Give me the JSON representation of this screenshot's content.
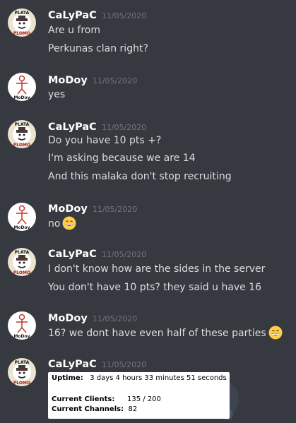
{
  "messages": [
    {
      "author": "CaLyPaC",
      "avatar": "plata-o-plomo-avatar",
      "timestamp": "11/05/2020",
      "lines": [
        "Are u from",
        "Perkunas clan right?"
      ]
    },
    {
      "author": "MoDoy",
      "avatar": "stick-figure-modoy-avatar",
      "timestamp": "11/05/2020",
      "lines": [
        "yes"
      ]
    },
    {
      "author": "CaLyPaC",
      "avatar": "plata-o-plomo-avatar",
      "timestamp": "11/05/2020",
      "lines": [
        "Do you have 10 pts +?",
        "I'm asking because we are 14",
        "And this malaka don't stop recruiting"
      ]
    },
    {
      "author": "MoDoy",
      "avatar": "stick-figure-modoy-avatar",
      "timestamp": "11/05/2020",
      "lines": [
        "no"
      ],
      "emoji": "grinning-face-emoji"
    },
    {
      "author": "CaLyPaC",
      "avatar": "plata-o-plomo-avatar",
      "timestamp": "11/05/2020",
      "lines": [
        "I don't know how are the sides in the server",
        "You don't have 10 pts? they said u have 16"
      ]
    },
    {
      "author": "MoDoy",
      "avatar": "stick-figure-modoy-avatar",
      "timestamp": "11/05/2020",
      "lines": [
        "16? we dont have even half of these parties"
      ],
      "emoji": "grinning-face-emoji"
    },
    {
      "author": "CaLyPaC",
      "avatar": "plata-o-plomo-avatar",
      "timestamp": "11/05/2020",
      "lines": []
    }
  ],
  "server_stats": {
    "uptime_label": "Uptime:",
    "uptime_value": "3 days 4 hours 33 minutes 51 seconds",
    "clients_label": "Current Clients:",
    "clients_value": "135 / 200",
    "channels_label": "Current Channels:",
    "channels_value": "82"
  },
  "avatar_texts": {
    "plata": "PLATA",
    "plomo": "PLOMO",
    "modoy": "MoDoy"
  },
  "colors": {
    "background": "#36393f",
    "username": "#ffffff",
    "message_text": "#dcddde",
    "timestamp": "#72767d"
  }
}
